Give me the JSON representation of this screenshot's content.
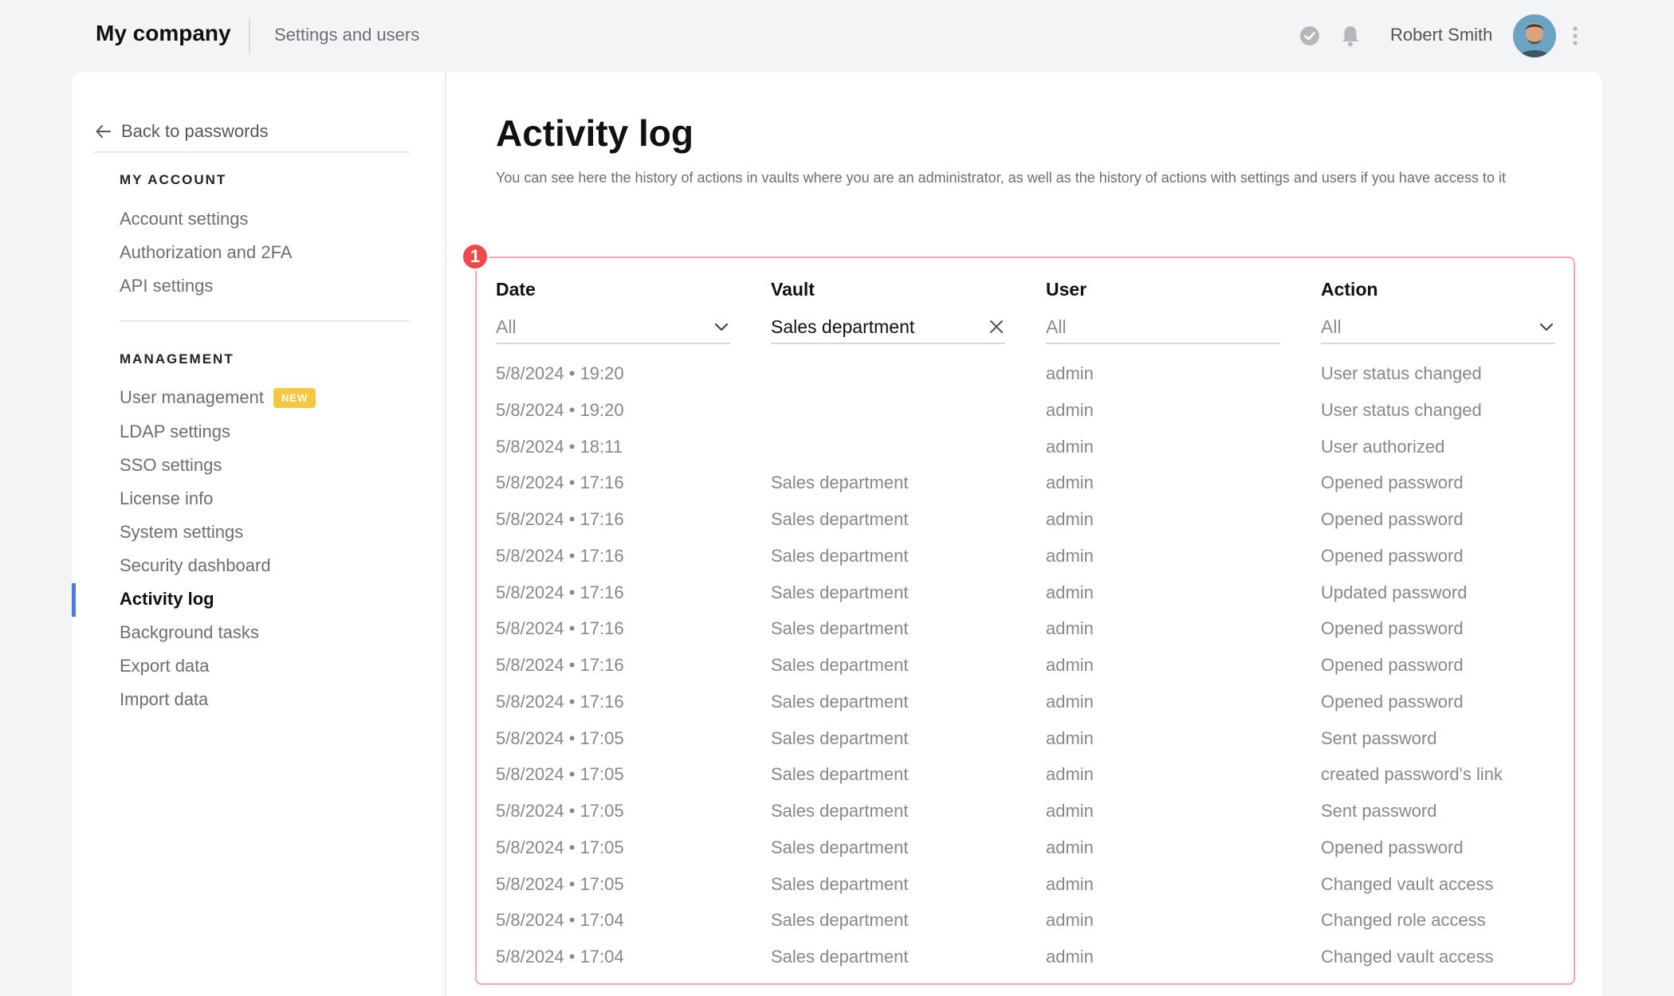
{
  "topbar": {
    "brand": "My company",
    "breadcrumb": "Settings and users",
    "username": "Robert Smith"
  },
  "sidebar": {
    "back_label": "Back to passwords",
    "my_account_title": "MY ACCOUNT",
    "my_account_items": [
      {
        "label": "Account settings"
      },
      {
        "label": "Authorization and 2FA"
      },
      {
        "label": "API settings"
      }
    ],
    "management_title": "MANAGEMENT",
    "management_items": [
      {
        "label": "User management",
        "badge": "NEW"
      },
      {
        "label": "LDAP settings"
      },
      {
        "label": "SSO settings"
      },
      {
        "label": "License info"
      },
      {
        "label": "System settings"
      },
      {
        "label": "Security dashboard"
      },
      {
        "label": "Activity log",
        "active": true
      },
      {
        "label": "Background tasks"
      },
      {
        "label": "Export data"
      },
      {
        "label": "Import data"
      }
    ]
  },
  "main": {
    "title": "Activity log",
    "description": "You can see here the history of actions in vaults where you are an administrator, as well as the history of actions with settings and users if you have access to it",
    "marker": "1",
    "columns": {
      "date": "Date",
      "vault": "Vault",
      "user": "User",
      "action": "Action"
    },
    "filters": {
      "date": "All",
      "vault": "Sales department",
      "user": "All",
      "action": "All"
    },
    "rows": [
      {
        "date": "5/8/2024 • 19:20",
        "vault": "",
        "user": "admin",
        "action": "User status changed"
      },
      {
        "date": "5/8/2024 • 19:20",
        "vault": "",
        "user": "admin",
        "action": "User status changed"
      },
      {
        "date": "5/8/2024 • 18:11",
        "vault": "",
        "user": "admin",
        "action": "User authorized"
      },
      {
        "date": "5/8/2024 • 17:16",
        "vault": "Sales department",
        "user": "admin",
        "action": "Opened password"
      },
      {
        "date": "5/8/2024 • 17:16",
        "vault": "Sales department",
        "user": "admin",
        "action": "Opened password"
      },
      {
        "date": "5/8/2024 • 17:16",
        "vault": "Sales department",
        "user": "admin",
        "action": "Opened password"
      },
      {
        "date": "5/8/2024 • 17:16",
        "vault": "Sales department",
        "user": "admin",
        "action": "Updated password"
      },
      {
        "date": "5/8/2024 • 17:16",
        "vault": "Sales department",
        "user": "admin",
        "action": "Opened password"
      },
      {
        "date": "5/8/2024 • 17:16",
        "vault": "Sales department",
        "user": "admin",
        "action": "Opened password"
      },
      {
        "date": "5/8/2024 • 17:16",
        "vault": "Sales department",
        "user": "admin",
        "action": "Opened password"
      },
      {
        "date": "5/8/2024 • 17:05",
        "vault": "Sales department",
        "user": "admin",
        "action": "Sent password"
      },
      {
        "date": "5/8/2024 • 17:05",
        "vault": "Sales department",
        "user": "admin",
        "action": "created password's link"
      },
      {
        "date": "5/8/2024 • 17:05",
        "vault": "Sales department",
        "user": "admin",
        "action": "Sent password"
      },
      {
        "date": "5/8/2024 • 17:05",
        "vault": "Sales department",
        "user": "admin",
        "action": "Opened password"
      },
      {
        "date": "5/8/2024 • 17:05",
        "vault": "Sales department",
        "user": "admin",
        "action": "Changed vault access"
      },
      {
        "date": "5/8/2024 • 17:04",
        "vault": "Sales department",
        "user": "admin",
        "action": "Changed role access"
      },
      {
        "date": "5/8/2024 • 17:04",
        "vault": "Sales department",
        "user": "admin",
        "action": "Changed vault access"
      }
    ]
  },
  "colors": {
    "accent": "#4a7bd8",
    "highlight_border": "#f3a7a7",
    "marker": "#ef4a4a",
    "badge": "#f5c842"
  }
}
